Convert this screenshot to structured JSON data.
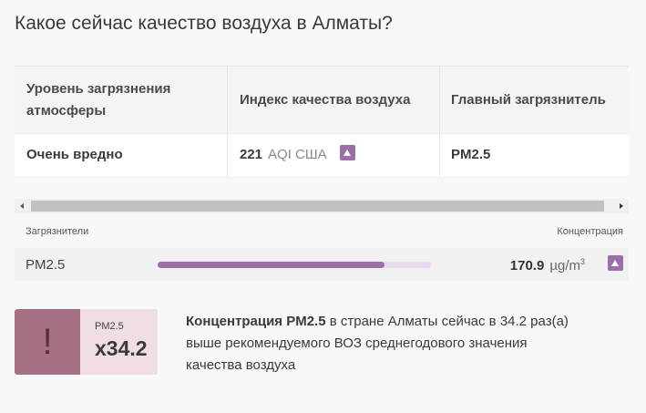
{
  "heading": "Какое сейчас качество воздуха в Алматы?",
  "table": {
    "headers": [
      "Уровень загрязнения атмосферы",
      "Индекс качества воздуха",
      "Главный загрязнитель"
    ],
    "level": "Очень вредно",
    "aqi_value": "221",
    "aqi_unit": "AQI США",
    "main_pollutant": "PM2.5"
  },
  "pollutants": {
    "col_pollutant": "Загрязнители",
    "col_concentration": "Концентрация",
    "items": [
      {
        "name": "PM2.5",
        "value": "170.9",
        "unit": "µg/m",
        "unit_sup": "3",
        "bar_fraction": 0.83
      }
    ]
  },
  "ratio": {
    "icon": "!",
    "pollutant": "PM2.5",
    "value": "x34.2",
    "text_bold": "Концентрация PM2.5",
    "text_rest": " в стране Алматы сейчас в 34.2 раз(а) выше рекомендуемого ВОЗ среднегодового значения качества воздуха"
  },
  "colors": {
    "accent": "#9b6fa8",
    "bar_track": "#e8d9ec",
    "ratio_bg": "#f0dde7",
    "ratio_mark": "#a56f86"
  },
  "icons": {
    "trend": "triangle-up-icon",
    "scroll_left": "arrow-left-icon",
    "scroll_right": "arrow-right-icon",
    "warning": "exclamation-icon"
  }
}
